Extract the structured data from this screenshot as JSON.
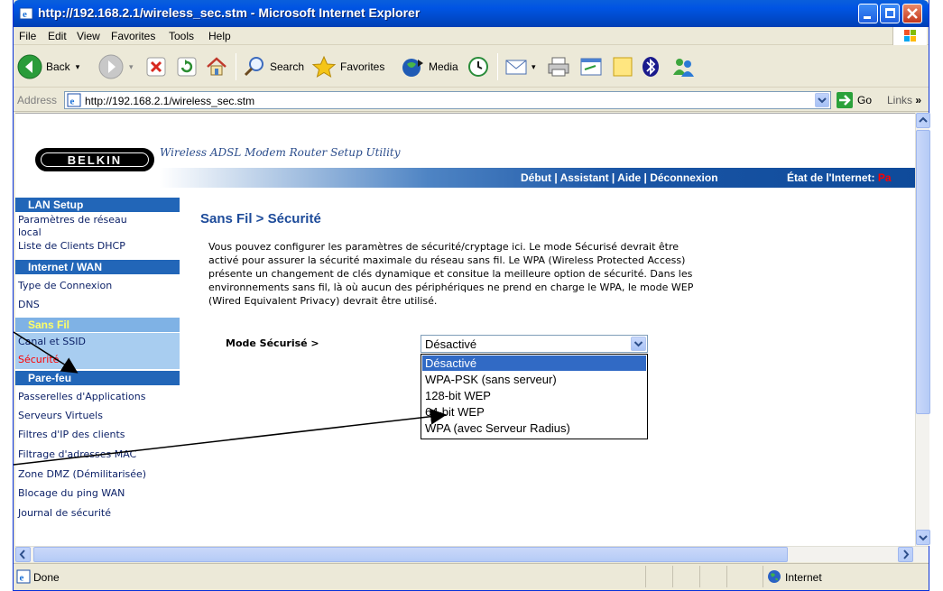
{
  "window": {
    "title": "http://192.168.2.1/wireless_sec.stm - Microsoft Internet Explorer"
  },
  "menubar": {
    "items": [
      {
        "label": "File",
        "key": "F"
      },
      {
        "label": "Edit",
        "key": "E"
      },
      {
        "label": "View",
        "key": "V"
      },
      {
        "label": "Favorites",
        "key": "a"
      },
      {
        "label": "Tools",
        "key": "T"
      },
      {
        "label": "Help",
        "key": "H"
      }
    ]
  },
  "toolbar": {
    "back_label": "Back",
    "search_label": "Search",
    "favorites_label": "Favorites",
    "media_label": "Media"
  },
  "address": {
    "label": "Address",
    "url": "http://192.168.2.1/wireless_sec.stm",
    "go_label": "Go",
    "links_label": "Links"
  },
  "page": {
    "logo": "BELKIN",
    "tagline": "Wireless ADSL Modem Router Setup Utility",
    "nav_links": "Début | Assistant | Aide | Déconnexion",
    "internet_label": "État de l'Internet:",
    "internet_value": "Pa"
  },
  "sidebar": {
    "sections": [
      {
        "title": "LAN Setup",
        "items": [
          "Paramètres de réseau local",
          "Liste de Clients DHCP"
        ]
      },
      {
        "title": "Internet / WAN",
        "items": [
          "Type de Connexion",
          "DNS"
        ]
      },
      {
        "title": "Sans Fil",
        "items": [
          "Canal et SSID",
          "Sécurité"
        ]
      },
      {
        "title": "Pare-feu",
        "items": [
          "Passerelles d'Applications",
          "Serveurs Virtuels",
          "Filtres d'IP des clients",
          "Filtrage d'adresses MAC",
          "Zone DMZ (Démilitarisée)",
          "Blocage du ping WAN",
          "Journal de sécurité"
        ]
      }
    ],
    "item_lan_1": "Paramètres de réseau",
    "item_lan_1b": "local"
  },
  "main": {
    "title": "Sans Fil > Sécurité",
    "intro_lines": [
      "Vous pouvez configurer les paramètres de sécurité/cryptage ici. Le mode Sécurisé devrait être",
      "activé pour assurer la sécurité maximale du réseau sans fil. Le WPA (Wireless Protected Access)",
      "présente un changement de clés dynamique et consitue la meilleure option de sécurité. Dans les",
      "environnements sans fil, là où aucun des périphériques ne prend en charge le WPA, le mode WEP",
      "(Wired Equivalent Privacy) devrait être utilisé."
    ],
    "mode_label": "Mode Sécurisé >",
    "mode_value": "Désactivé",
    "options": [
      "Désactivé",
      "WPA-PSK (sans serveur)",
      "128-bit WEP",
      "64-bit WEP",
      "WPA (avec Serveur Radius)"
    ]
  },
  "status": {
    "text": "Done",
    "zone": "Internet"
  },
  "colors": {
    "titlebar": "#0054e3",
    "sidebar_header": "#2266b8",
    "active_section": "#7fb2e5",
    "selected_option": "#316ac5",
    "title_text": "#1d4b9a",
    "alert": "#ff0000"
  }
}
